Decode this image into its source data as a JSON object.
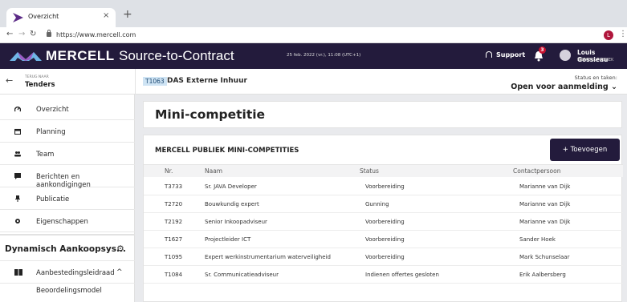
{
  "browser": {
    "tab_title": "Overzicht",
    "tab_close": "×",
    "new_tab": "+",
    "url": "https://www.mercell.com",
    "profile_initial": "L"
  },
  "app": {
    "brand": "MERCELL",
    "product": "Source-to-Contract",
    "datetime": "25 feb. 2022 (vr.), 11:08 (UTC+1)",
    "support_label": "Support",
    "notification_count": "3",
    "user_name": "Louis Gossieau",
    "user_org": "MERCELL PUBLIEK"
  },
  "subheader": {
    "back_small": "TERUG NAAR",
    "back_label": "Tenders",
    "code": "T1063",
    "tender_title": "DAS Externe Inhuur",
    "status_label": "Status en taken:",
    "status_value": "Open voor aanmelding ⌄"
  },
  "sidebar": {
    "items": [
      {
        "label": "Overzicht"
      },
      {
        "label": "Planning"
      },
      {
        "label": "Team"
      },
      {
        "label": "Berichten en aankondigingen"
      },
      {
        "label": "Publicatie"
      },
      {
        "label": "Eigenschappen"
      }
    ],
    "section_title": "Dynamisch Aankoopsys...",
    "sub_item": "Aanbestedingsleidraad",
    "sub_sub_item": "Beoordelingsmodel"
  },
  "main": {
    "page_title": "Mini-competitie",
    "list_title": "MERCELL PUBLIEK MINI-COMPETITIES",
    "add_button": "+ Toevoegen",
    "columns": [
      "Nr.",
      "Naam",
      "Status",
      "Contactpersoon"
    ],
    "rows": [
      {
        "nr": "T3733",
        "naam": "Sr. JAVA Developer",
        "status": "Voorbereiding",
        "contact": "Marianne van Dijk"
      },
      {
        "nr": "T2720",
        "naam": "Bouwkundig expert",
        "status": "Gunning",
        "contact": "Marianne van Dijk"
      },
      {
        "nr": "T2192",
        "naam": "Senior Inkoopadviseur",
        "status": "Voorbereiding",
        "contact": "Marianne van Dijk"
      },
      {
        "nr": "T1627",
        "naam": "Projectleider ICT",
        "status": "Voorbereiding",
        "contact": "Sander Hoek"
      },
      {
        "nr": "T1095",
        "naam": "Expert werkinstrumentarium waterveiligheid",
        "status": "Voorbereiding",
        "contact": "Mark Schunselaar"
      },
      {
        "nr": "T1084",
        "naam": "Sr. Communicatieadviseur",
        "status": "Indienen offertes gesloten",
        "contact": "Erik Aalbersberg"
      }
    ]
  },
  "colors": {
    "header_bg": "#231b3c",
    "accent": "#231b3c",
    "code_badge_bg": "#cfe4f4"
  }
}
